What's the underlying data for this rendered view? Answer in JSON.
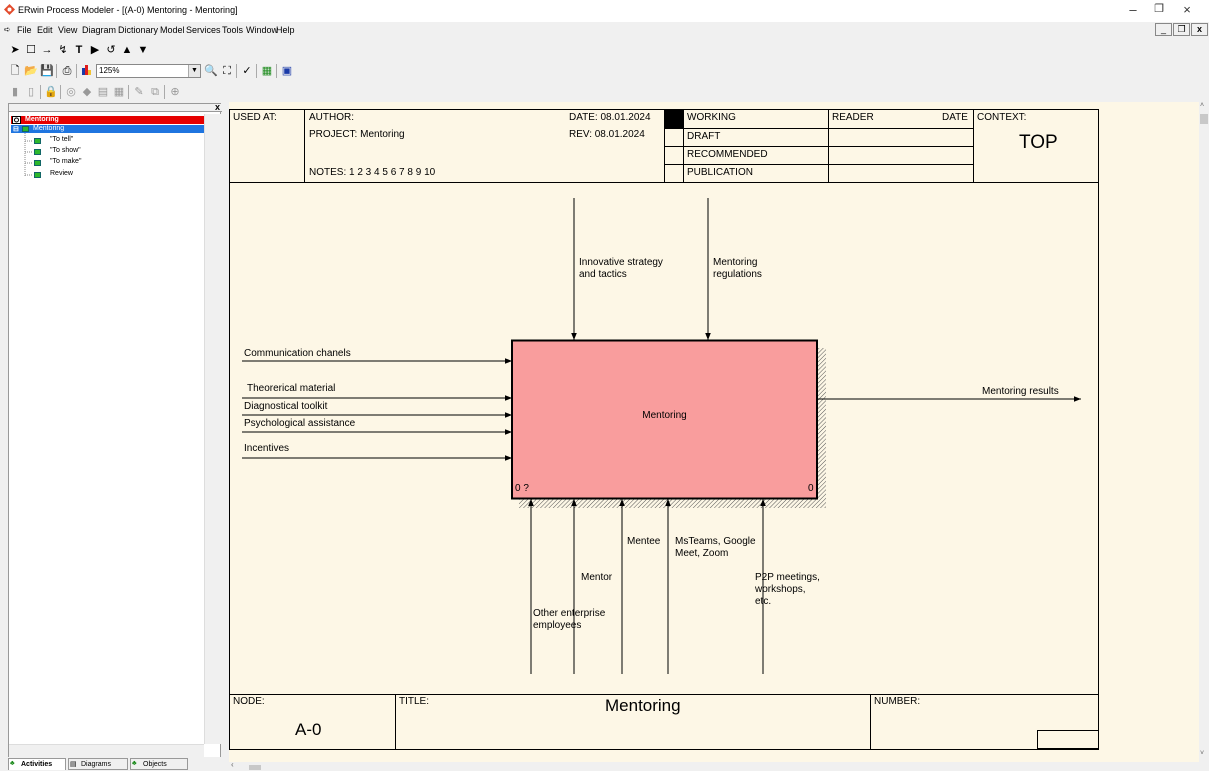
{
  "window": {
    "title": "ERwin Process Modeler - [(A-0) Mentoring - Mentoring]"
  },
  "menu": [
    "File",
    "Edit",
    "View",
    "Diagram",
    "Dictionary",
    "Model",
    "Services",
    "Tools",
    "Window",
    "Help"
  ],
  "toolbar": {
    "zoom_value": "125%"
  },
  "tree": {
    "root": "Mentoring",
    "selected": "Mentoring",
    "children": [
      "\"To tell\"",
      "\"To show\"",
      "\"To make\"",
      "Review"
    ]
  },
  "tabs": [
    "Activities",
    "Diagrams",
    "Objects"
  ],
  "header": {
    "used_at": "USED AT:",
    "author": "AUTHOR:",
    "project": "PROJECT:  Mentoring",
    "notes": "NOTES:  1  2  3  4  5  6  7  8  9  10",
    "date": "DATE:  08.01.2024",
    "rev": "REV:   08.01.2024",
    "working": "WORKING",
    "draft": "DRAFT",
    "recommended": "RECOMMENDED",
    "publication": "PUBLICATION",
    "reader": "READER",
    "date2": "DATE",
    "context": "CONTEXT:",
    "top": "TOP"
  },
  "diagram": {
    "box_label": "Mentoring",
    "box_left_num": "0 ?",
    "box_right_num": "0",
    "box_color": "#f99d9d",
    "controls": [
      "Innovative strategy\nand tactics",
      "Mentoring\nregulations"
    ],
    "inputs": [
      "Communication chanels",
      "Theorerical material",
      "Diagnostical toolkit",
      "Psychological assistance",
      "Incentives"
    ],
    "output": "Mentoring results",
    "mechanisms": {
      "other": "Other enterprise\nemployees",
      "mentor": "Mentor",
      "mentee": "Mentee",
      "msteams": "MsTeams, Google\nMeet, Zoom",
      "p2p": "P2P meetings,\nworkshops,\netc."
    }
  },
  "footer": {
    "node": "NODE:",
    "node_value": "A-0",
    "title": "TITLE:",
    "title_value": "Mentoring",
    "number": "NUMBER:"
  }
}
